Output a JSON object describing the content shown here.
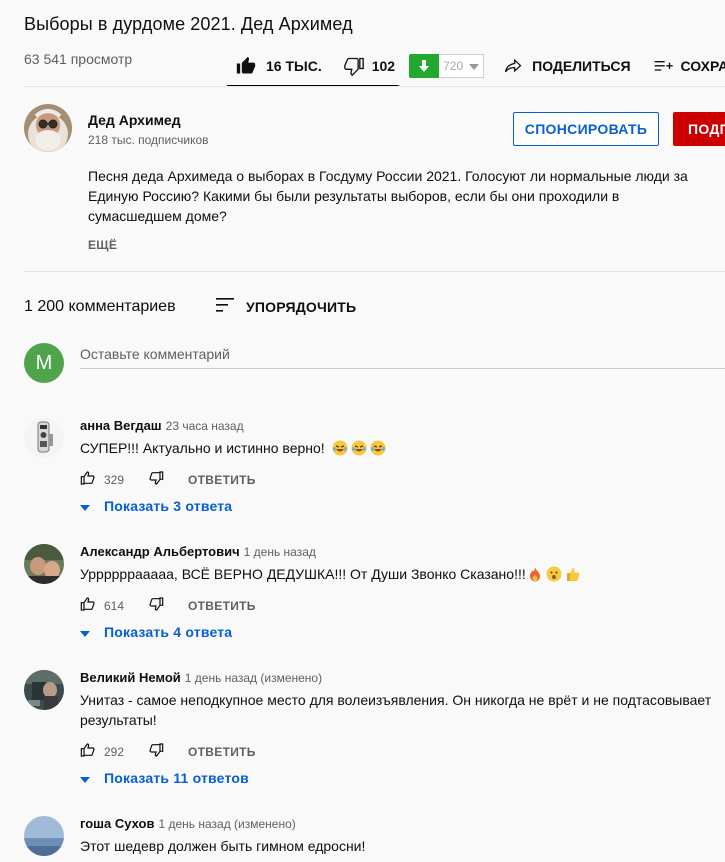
{
  "video": {
    "title": "Выборы в дурдоме 2021. Дед Архимед",
    "views": "63 541 просмотр",
    "rating_fill_fraction": 0.99
  },
  "actions": {
    "like_label": "16 ТЫС.",
    "dislike_label": "102",
    "ext_dislike_count": "720",
    "share_label": "ПОДЕЛИТЬСЯ",
    "save_label": "СОХРА"
  },
  "channel": {
    "name": "Дед Архимед",
    "subscribers": "218 тыс. подписчиков",
    "sponsor_label": "СПОНСИРОВАТЬ",
    "subscribe_label": "ПОДП"
  },
  "description": {
    "text": "Песня деда Архимеда о выборах в Госдуму России 2021. Голосуют ли нормальные люди за Единую Россию? Какими бы были результаты выборов, если бы они проходили в сумасшедшем доме?",
    "more_label": "ЕЩЁ"
  },
  "comments_header": {
    "count": "1 200 комментариев",
    "sort_label": "УПОРЯДОЧИТЬ"
  },
  "new_comment": {
    "avatar_letter": "M",
    "placeholder": "Оставьте комментарий"
  },
  "comments": [
    {
      "author": "анна Вегдаш",
      "time": "23 часа назад",
      "text": "СУПЕР!!! Актуально и истинно верно!",
      "emoji": [
        "laugh-cry-emoji",
        "laugh-cry-emoji",
        "laugh-cry-emoji"
      ],
      "likes": "329",
      "reply_label": "ОТВЕТИТЬ",
      "replies": "Показать 3 ответа"
    },
    {
      "author": "Александр Альбертович",
      "time": "1 день назад",
      "text": "Урррррраааaa, ВСЁ ВЕРНО ДЕДУШКА!!! От Души Звонко Сказано!!!",
      "emoji": [
        "fire-emoji",
        "hushed-emoji",
        "thumbs-up-emoji"
      ],
      "likes": "614",
      "reply_label": "ОТВЕТИТЬ",
      "replies": "Показать 4 ответа"
    },
    {
      "author": "Великий Немой",
      "time": "1 день назад (изменено)",
      "text": "Унитаз - самое неподкупное место для волеизъявления. Он никогда не врёт и не подтасовывает результаты!",
      "likes": "292",
      "reply_label": "ОТВЕТИТЬ",
      "replies": "Показать 11 ответов"
    },
    {
      "author": "гоша Сухов",
      "time": "1 день назад (изменено)",
      "text": "Этот шедевр должен быть гимном едросни!"
    }
  ],
  "colors": {
    "link_blue": "#065fd4",
    "subscribe_red": "#cc0000",
    "ext_green": "#21a82e",
    "my_avatar_green": "#4fa34b"
  }
}
